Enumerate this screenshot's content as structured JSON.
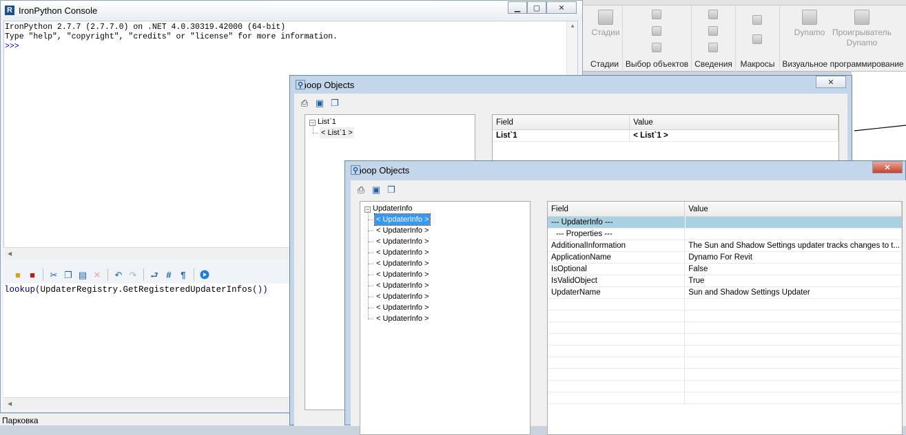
{
  "ribbon": {
    "groups": [
      {
        "label": "Стадии",
        "buttons": [
          "Стадии"
        ]
      },
      {
        "label": "Выбор объектов",
        "buttons": []
      },
      {
        "label": "Сведения",
        "buttons": []
      },
      {
        "label": "Макросы",
        "buttons": []
      },
      {
        "label": "Визуальное программирование",
        "buttons": [
          "Dynamo",
          "Проигрыватель Dynamo"
        ]
      }
    ]
  },
  "ironpython": {
    "title": "IronPython Console",
    "output_lines": [
      "IronPython 2.7.7 (2.7.7.0) on .NET 4.0.30319.42000 (64-bit)",
      "Type \"help\", \"copyright\", \"credits\" or \"license\" for more information."
    ],
    "prompt": ">>>",
    "editor": {
      "func": "lookup",
      "arg": "UpdaterRegistry.GetRegisteredUpdaterInfos",
      "open_paren": "(",
      "close_parens": "())"
    },
    "toolbar_icons": [
      "open-icon",
      "save-icon",
      "cut-icon",
      "copy-icon",
      "paste-icon",
      "delete-icon",
      "undo-icon",
      "redo-icon",
      "word-wrap-icon",
      "line-numbers-icon",
      "whitespace-icon",
      "run-icon"
    ]
  },
  "status": {
    "view_name": "Парковка"
  },
  "snoop1": {
    "title": "Snoop Objects",
    "tree": {
      "root": "List`1",
      "children": [
        "< List`1 >"
      ]
    },
    "columns": [
      "Field",
      "Value"
    ],
    "rows": [
      {
        "field": "List`1",
        "value": "< List`1 >"
      }
    ]
  },
  "snoop2": {
    "title": "Snoop Objects",
    "tree": {
      "root": "UpdaterInfo",
      "children": [
        "< UpdaterInfo >",
        "< UpdaterInfo >",
        "< UpdaterInfo >",
        "< UpdaterInfo >",
        "< UpdaterInfo >",
        "< UpdaterInfo >",
        "< UpdaterInfo >",
        "< UpdaterInfo >",
        "< UpdaterInfo >",
        "< UpdaterInfo >"
      ]
    },
    "columns": [
      "Field",
      "Value"
    ],
    "class_row": "--- UpdaterInfo ---",
    "section_row": "--- Properties ---",
    "rows": [
      {
        "field": "AdditionalInformation",
        "value": "The Sun and Shadow Settings updater tracks changes to t..."
      },
      {
        "field": "ApplicationName",
        "value": "Dynamo For Revit"
      },
      {
        "field": "IsOptional",
        "value": "False"
      },
      {
        "field": "IsValidObject",
        "value": "True"
      },
      {
        "field": "UpdaterName",
        "value": "Sun and Shadow Settings Updater"
      }
    ]
  }
}
